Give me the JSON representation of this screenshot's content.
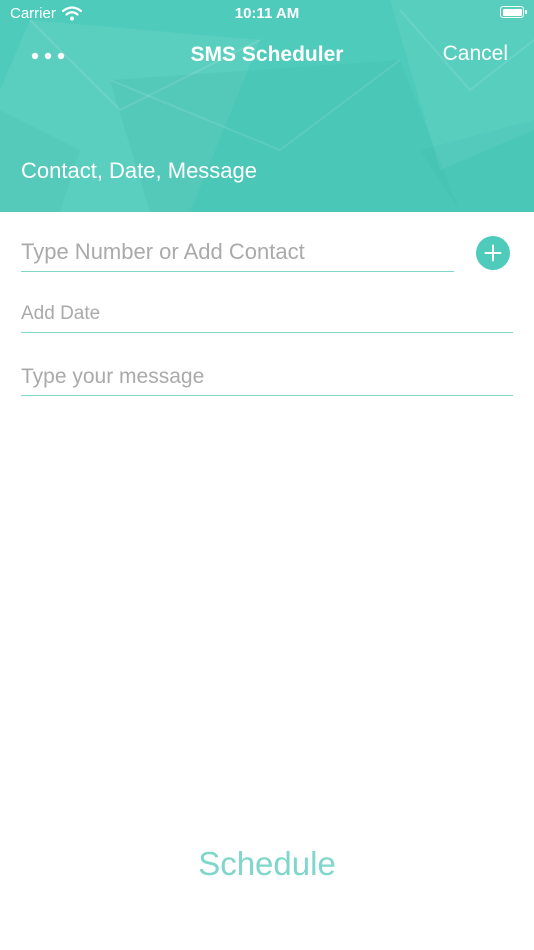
{
  "status_bar": {
    "carrier": "Carrier",
    "time": "10:11 AM",
    "wifi_icon": "wifi-icon",
    "battery_icon": "battery-icon"
  },
  "nav": {
    "more_icon": "more-dots-icon",
    "title": "SMS Scheduler",
    "cancel_label": "Cancel"
  },
  "header": {
    "subtitle": "Contact, Date, Message"
  },
  "form": {
    "contact_placeholder": "Type Number or Add Contact",
    "contact_value": "",
    "add_contact_icon": "plus-icon",
    "date_placeholder": "Add Date",
    "date_value": "",
    "message_placeholder": "Type your message",
    "message_value": ""
  },
  "footer": {
    "schedule_label": "Schedule"
  },
  "colors": {
    "accent": "#4ecbbb",
    "accent_light": "#7fd6ca",
    "placeholder": "#aaaaaa"
  }
}
